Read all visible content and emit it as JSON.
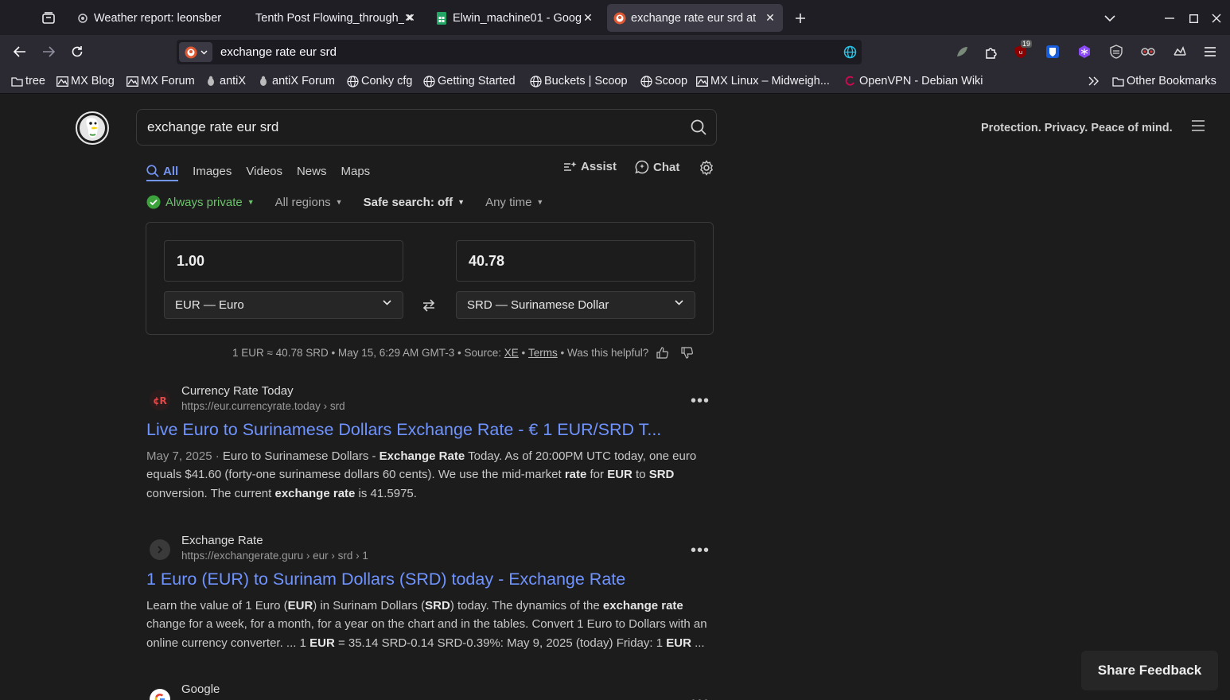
{
  "browser": {
    "tabs": [
      {
        "title": "Weather report: leonsber",
        "icon": "weather-favicon",
        "active": false
      },
      {
        "title": "Tenth Post Flowing_through_",
        "icon": "none",
        "active": false
      },
      {
        "title": "Elwin_machine01 - Googl",
        "icon": "google-sheets-favicon",
        "active": false
      },
      {
        "title": "exchange rate eur srd at",
        "icon": "duckduckgo-favicon",
        "active": true
      }
    ],
    "url": "exchange rate eur srd",
    "extension_badge": "19",
    "bookmarks": [
      {
        "label": "tree",
        "icon": "folder-icon"
      },
      {
        "label": "MX Blog",
        "icon": "mx-icon"
      },
      {
        "label": "MX Forum",
        "icon": "mx-icon"
      },
      {
        "label": "antiX",
        "icon": "antix-icon"
      },
      {
        "label": "antiX Forum",
        "icon": "antix-icon"
      },
      {
        "label": "Conky cfg",
        "icon": "globe-icon"
      },
      {
        "label": "Getting Started",
        "icon": "globe-icon"
      },
      {
        "label": "Buckets | Scoop",
        "icon": "globe-icon"
      },
      {
        "label": "Scoop",
        "icon": "globe-icon"
      },
      {
        "label": "MX Linux – Midweigh...",
        "icon": "mx-icon"
      },
      {
        "label": "OpenVPN - Debian Wiki",
        "icon": "debian-icon"
      }
    ],
    "other_bookmarks": "Other Bookmarks"
  },
  "search": {
    "query": "exchange rate eur srd",
    "tagline": "Protection. Privacy. Peace of mind.",
    "tabs": [
      "All",
      "Images",
      "Videos",
      "News",
      "Maps"
    ],
    "assist": "Assist",
    "chat": "Chat",
    "filters": {
      "private": "Always private",
      "regions": "All regions",
      "safe": "Safe search: off",
      "time": "Any time"
    }
  },
  "converter": {
    "from_amount": "1.00",
    "to_amount": "40.78",
    "from_currency": "EUR — Euro",
    "to_currency": "SRD — Surinamese Dollar",
    "rate_text": "1 EUR ≈ 40.78 SRD • May 15, 6:29 AM GMT-3 • Source: ",
    "source": "XE",
    "sep": " • ",
    "terms": "Terms",
    "helpful": " • Was this helpful?"
  },
  "results": [
    {
      "site": "Currency Rate Today",
      "url": "https://eur.currencyrate.today › srd",
      "title": "Live Euro to Surinamese Dollars Exchange Rate - € 1 EUR/SRD T...",
      "date": "May 7, 2025",
      "snippet_html": "Euro to Surinamese Dollars - <b>Exchange Rate</b> Today. As of 20:00PM UTC today, one euro equals $41.60 (forty-one surinamese dollars 60 cents). We use the mid-market <b>rate</b> for <b>EUR</b> to <b>SRD</b> conversion. The current <b>exchange rate</b> is 41.5975."
    },
    {
      "site": "Exchange Rate",
      "url": "https://exchangerate.guru › eur › srd › 1",
      "title": "1 Euro (EUR) to Surinam Dollars (SRD) today - Exchange Rate",
      "snippet_html": "Learn the value of 1 Euro (<b>EUR</b>) in Surinam Dollars (<b>SRD</b>) today. The dynamics of the <b>exchange rate</b> change for a week, for a month, for a year on the chart and in the tables. Convert 1 Euro to Dollars with an online currency converter. ... 1 <b>EUR</b> = 35.14 SRD-0.14 SRD-0.39%: May 9, 2025 (today) Friday: 1 <b>EUR</b> ..."
    },
    {
      "site": "Google"
    }
  ],
  "feedback": "Share Feedback",
  "colors": {
    "link": "#6f93ff",
    "accent": "#7295f6",
    "private": "#6bc26b"
  }
}
